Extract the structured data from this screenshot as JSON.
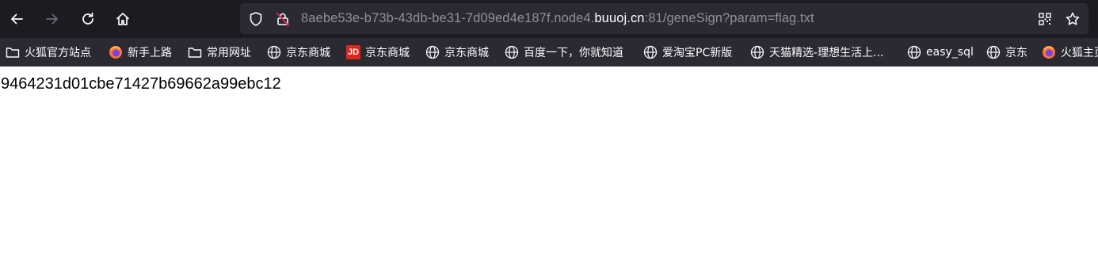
{
  "browser": {
    "toolbar_bg": "#1c1b22",
    "urlbar_bg": "#2b2a33",
    "nav": {
      "back_icon": "arrow-left-icon",
      "forward_icon": "arrow-right-icon",
      "reload_icon": "reload-icon",
      "home_icon": "home-icon"
    },
    "url": {
      "prefix_dim": "8aebe53e-b73b-43db-be31-7d09ed4e187f.node4.",
      "domain": "buuoj.cn",
      "suffix_dim": ":81/geneSign?param=flag.txt"
    }
  },
  "bookmarks": [
    {
      "icon": "folder-icon",
      "label": "火狐官方站点"
    },
    {
      "icon": "firefox-icon",
      "label": "新手上路"
    },
    {
      "icon": "folder-icon",
      "label": "常用网址"
    },
    {
      "icon": "globe-icon",
      "label": "京东商城"
    },
    {
      "icon": "jd-icon",
      "label": "京东商城",
      "badge": "JD"
    },
    {
      "icon": "globe-icon",
      "label": "京东商城"
    },
    {
      "icon": "globe-icon",
      "label": "百度一下，你就知道"
    },
    {
      "icon": "globe-icon",
      "label": "爱淘宝PC新版"
    },
    {
      "icon": "globe-icon",
      "label": "天猫精选-理想生活上..."
    },
    {
      "icon": "globe-icon",
      "label": "easy_sql"
    },
    {
      "icon": "globe-icon",
      "label": "京东"
    },
    {
      "icon": "firefox-icon",
      "label": "火狐主页"
    }
  ],
  "page": {
    "body_text": "9464231d01cbe71427b69662a99ebc12"
  }
}
